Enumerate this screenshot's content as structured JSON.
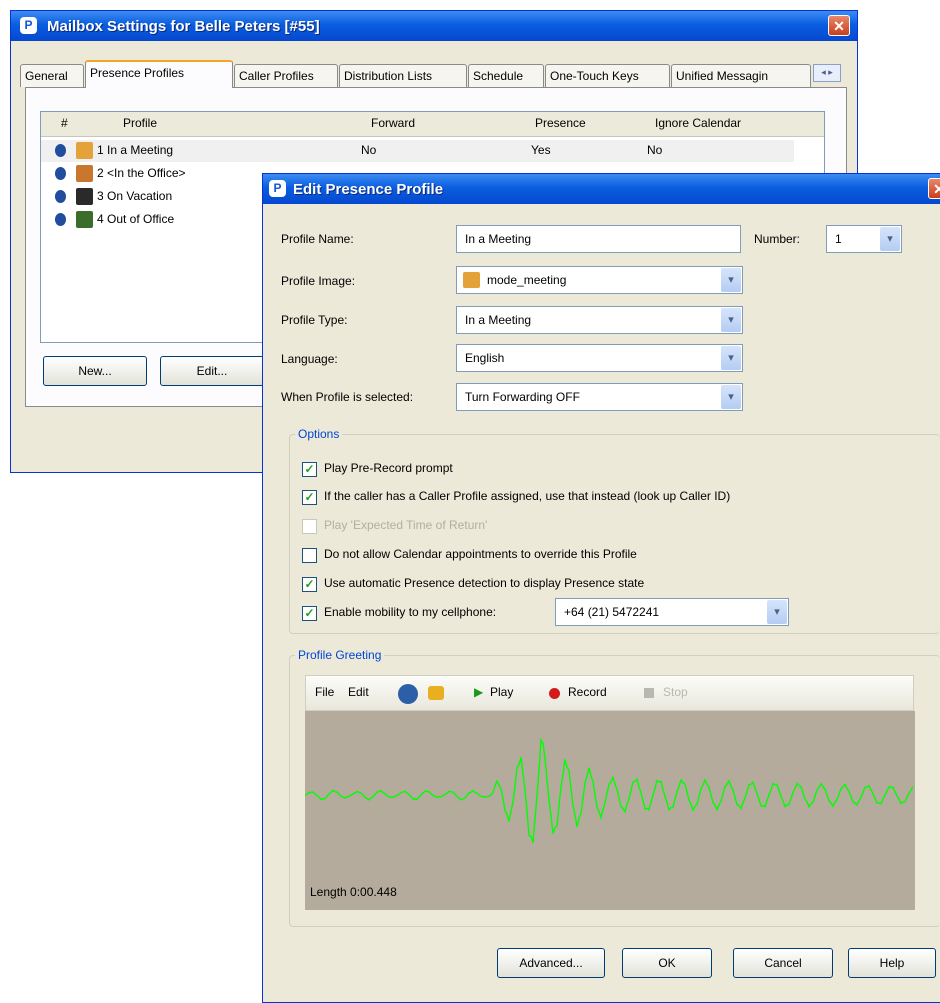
{
  "main_window": {
    "title": "Mailbox Settings for Belle Peters [#55]",
    "close_glyph": "✕",
    "tabs": [
      "General",
      "Presence Profiles",
      "Caller Profiles",
      "Distribution Lists",
      "Schedule",
      "One-Touch Keys",
      "Unified Messagin"
    ],
    "active_tab": "Presence Profiles",
    "columns": [
      "#",
      "Profile",
      "Forward",
      "Presence",
      "Ignore Calendar"
    ],
    "rows": [
      {
        "profile": "1 In a Meeting",
        "forward": "No",
        "presence": "Yes",
        "ignore_calendar": "No",
        "image_color": "#e3a23a"
      },
      {
        "profile": "2 <In the Office>",
        "forward": "",
        "presence": "",
        "ignore_calendar": "",
        "image_color": "#c9772f"
      },
      {
        "profile": "3 On Vacation",
        "forward": "",
        "presence": "",
        "ignore_calendar": "",
        "image_color": "#2a2a2a"
      },
      {
        "profile": "4 Out of Office",
        "forward": "",
        "presence": "",
        "ignore_calendar": "",
        "image_color": "#3a6e2a"
      }
    ],
    "buttons": {
      "new": "New...",
      "edit": "Edit..."
    }
  },
  "dialog": {
    "title": "Edit Presence Profile",
    "close_glyph": "✕",
    "profile_name_label": "Profile Name:",
    "profile_name_value": "In a Meeting",
    "number_label": "Number:",
    "number_value": "1",
    "profile_image_label": "Profile Image:",
    "profile_image_value": "mode_meeting",
    "profile_type_label": "Profile Type:",
    "profile_type_value": "In a Meeting",
    "language_label": "Language:",
    "language_value": "English",
    "when_selected_label": "When Profile is selected:",
    "when_selected_value": "Turn Forwarding OFF",
    "options_title": "Options",
    "options": [
      {
        "label": "Play Pre-Record prompt",
        "checked": true,
        "enabled": true
      },
      {
        "label": "If the caller has a Caller Profile assigned, use that instead (look up Caller ID)",
        "checked": true,
        "enabled": true
      },
      {
        "label": "Play 'Expected Time of Return'",
        "checked": false,
        "enabled": false
      },
      {
        "label": "Do not allow Calendar appointments to override this Profile",
        "checked": false,
        "enabled": true
      },
      {
        "label": "Use automatic Presence detection to display Presence state",
        "checked": true,
        "enabled": true
      },
      {
        "label": "Enable mobility to my cellphone:",
        "checked": true,
        "enabled": true
      }
    ],
    "cellphone_value": "+64 (21) 5472241",
    "greeting_title": "Profile Greeting",
    "toolbar": {
      "file": "File",
      "edit": "Edit",
      "play": "Play",
      "record": "Record",
      "stop": "Stop"
    },
    "waveform_color": "#00ff00",
    "length_label": "Length 0:00.448",
    "buttons": {
      "advanced": "Advanced...",
      "ok": "OK",
      "cancel": "Cancel",
      "help": "Help"
    }
  },
  "dropdown_glyph": "▾",
  "check_glyph": "✓"
}
